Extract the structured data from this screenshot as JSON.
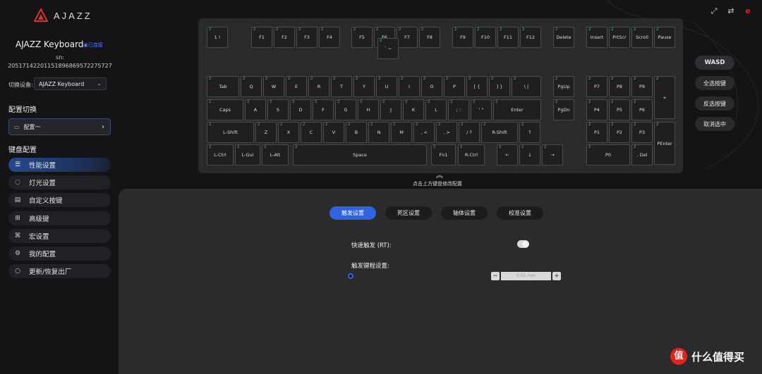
{
  "brand": {
    "logo_text": "AJAZZ"
  },
  "device": {
    "name": "AJAZZ Keyboard",
    "connection": "已连接",
    "sn_label": "sn:",
    "sn": "20517142201151896869572275727"
  },
  "switch_device": {
    "label": "切换设备:",
    "value": "AJAZZ Keyboard"
  },
  "profile_section": {
    "title": "配置切换",
    "current": "配置一"
  },
  "keyboard_section": {
    "title": "键盘配置",
    "items": [
      {
        "label": "性能设置",
        "icon": "sliders-icon",
        "active": true
      },
      {
        "label": "灯光设置",
        "icon": "bulb-icon",
        "active": false
      },
      {
        "label": "自定义按键",
        "icon": "keyboard-icon",
        "active": false
      },
      {
        "label": "高级键",
        "icon": "grid-icon",
        "active": false
      },
      {
        "label": "宏设置",
        "icon": "macro-icon",
        "active": false
      },
      {
        "label": "我的配置",
        "icon": "gear-icon",
        "active": false
      },
      {
        "label": "更新/恢复出厂",
        "icon": "circle-icon",
        "active": false
      }
    ]
  },
  "keyboard": {
    "level_marker": "2",
    "keys": [
      "1 !",
      "F1",
      "F2",
      "F3",
      "F4",
      "F5",
      "F6",
      "F7",
      "F8",
      "F9",
      "F10",
      "F11",
      "F12",
      "Delete",
      "Insert",
      "PrtScr",
      "Scroll",
      "Pause",
      "` ~",
      "Tab",
      "Q",
      "W",
      "E",
      "R",
      "T",
      "Y",
      "U",
      "I",
      "O",
      "P",
      "[ {",
      "] }",
      "\\ |",
      "PgUp",
      "P7",
      "P8",
      "P9",
      "+",
      "Caps",
      "A",
      "S",
      "D",
      "F",
      "G",
      "H",
      "J",
      "K",
      "L",
      "; :",
      "' \"",
      "Enter",
      "PgDn",
      "P4",
      "P5",
      "P6",
      "L-Shift",
      "Z",
      "X",
      "C",
      "V",
      "B",
      "N",
      "M",
      ", <",
      ". >",
      "/ ?",
      "R-Shift",
      "↑",
      "P1",
      "P2",
      "P3",
      "PEnter",
      "L-Ctrl",
      "L-Gui",
      "L-Alt",
      "Space",
      "Fn1",
      "R-Ctrl",
      "←",
      "↓",
      "→",
      "P0",
      ". Del"
    ]
  },
  "hint": "点击上方键盘修改配置",
  "quick_buttons": [
    "WASD",
    "全选按键",
    "反选按键",
    "取消选中"
  ],
  "tabs": [
    "触发设置",
    "死区设置",
    "轴体设置",
    "校准设置"
  ],
  "trigger": {
    "rt_label": "快速触发 (RT):",
    "rt_on": true,
    "travel_label": "触发键程设置:",
    "travel_value_placeholder": "0.01 mm",
    "slider_level": 0
  },
  "watermark": {
    "badge": "值",
    "text": "什么值得买"
  },
  "colors": {
    "accent": "#2f63e0",
    "key_marker": "#35c8a0",
    "brand_red": "#e1251b"
  }
}
